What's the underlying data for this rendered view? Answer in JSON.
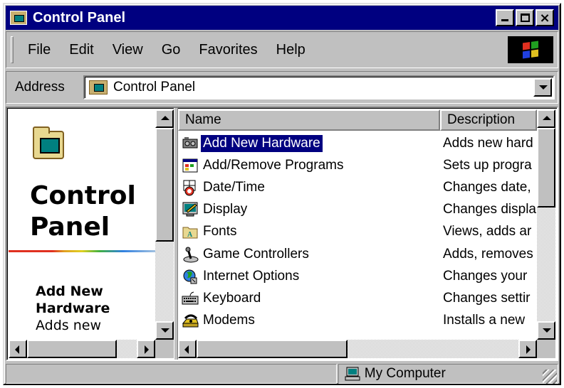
{
  "window": {
    "title": "Control Panel",
    "minimize_label": "",
    "close_label": "×"
  },
  "menu": {
    "items": [
      "File",
      "Edit",
      "View",
      "Go",
      "Favorites",
      "Help"
    ]
  },
  "address": {
    "label": "Address",
    "value": "Control Panel"
  },
  "left_pane": {
    "title": "Control Panel",
    "selected_name": "Add New Hardware",
    "selected_desc": "Adds new"
  },
  "list": {
    "columns": [
      "Name",
      "Description"
    ],
    "rows": [
      {
        "name": "Add New Hardware",
        "desc": "Adds new hard",
        "icon": "hardware-icon",
        "selected": true
      },
      {
        "name": "Add/Remove Programs",
        "desc": "Sets up progra",
        "icon": "programs-icon",
        "selected": false
      },
      {
        "name": "Date/Time",
        "desc": "Changes date,",
        "icon": "calendar-icon",
        "selected": false
      },
      {
        "name": "Display",
        "desc": "Changes displa",
        "icon": "display-icon",
        "selected": false
      },
      {
        "name": "Fonts",
        "desc": "Views, adds ar",
        "icon": "fonts-folder-icon",
        "selected": false
      },
      {
        "name": "Game Controllers",
        "desc": "Adds, removes",
        "icon": "joystick-icon",
        "selected": false
      },
      {
        "name": "Internet Options",
        "desc": "Changes your",
        "icon": "globe-icon",
        "selected": false
      },
      {
        "name": "Keyboard",
        "desc": "Changes settir",
        "icon": "keyboard-icon",
        "selected": false
      },
      {
        "name": "Modems",
        "desc": "Installs a new",
        "icon": "modem-icon",
        "selected": false
      }
    ]
  },
  "status": {
    "zone": "My Computer"
  },
  "colors": {
    "titlebar": "#000080",
    "selection": "#000080",
    "face": "#c0c0c0"
  }
}
